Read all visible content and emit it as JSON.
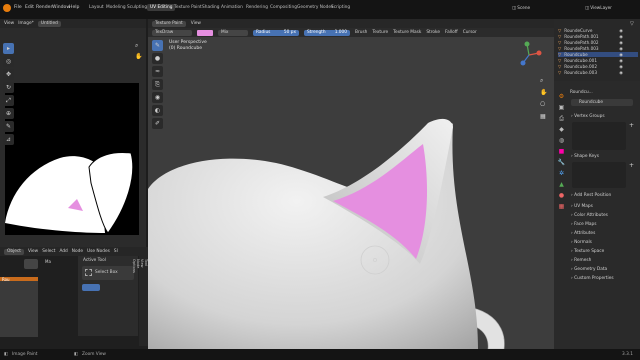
{
  "top_menu": [
    "File",
    "Edit",
    "Render",
    "Window",
    "Help"
  ],
  "workspaces": [
    "Layout",
    "Modeling",
    "Sculpting",
    "UV Editing",
    "Texture Paint",
    "Shading",
    "Animation",
    "Rendering",
    "Compositing",
    "Geometry Nodes",
    "Scripting"
  ],
  "active_workspace": "UV Editing",
  "scene_label": "Scene",
  "view_layer_label": "ViewLayer",
  "image_editor": {
    "menu": [
      "View",
      "Image*"
    ],
    "image_name": "Untitled"
  },
  "viewport_header": {
    "mode": "Texture Paint",
    "view": "View",
    "brush_name": "TexDraw",
    "blend": "Mix",
    "radius_label": "Radius",
    "radius_value": "50 px",
    "strength_label": "Strength",
    "strength_value": "1.000",
    "menus": [
      "Brush",
      "Texture",
      "Texture Mask",
      "Stroke",
      "Falloff",
      "Cursor"
    ]
  },
  "viewport_overlay": {
    "line1": "User Perspective",
    "line2": "(0) Roundcube"
  },
  "node_editor": {
    "header": [
      "Object",
      "View",
      "Select",
      "Add",
      "Node",
      "Use Nodes",
      "Sl"
    ],
    "active_tool_label": "Active Tool",
    "tool_name": "Select Box",
    "node_title": "Rou",
    "side_tabs": [
      "Tool",
      "View",
      "Node",
      "Options"
    ]
  },
  "outliner": {
    "items": [
      "RoundeCurve",
      "RoundePath.001",
      "RoundePath.002",
      "RoundePath.003",
      "Roundcube",
      "Roundcube.001",
      "Roundcube.002",
      "Roundcube.003"
    ],
    "selected_index": 4
  },
  "properties": {
    "object_label": "Roundcu...",
    "mesh_name": "Roundcube",
    "sections": [
      "Vertex Groups",
      "Shape Keys",
      "Add Rest Position",
      "UV Maps",
      "Color Attributes",
      "Face Maps",
      "Attributes",
      "Normals",
      "Texture Space",
      "Remesh",
      "Geometry Data",
      "Custom Properties"
    ]
  },
  "status_bar": {
    "left": "Image Paint",
    "middle": "Zoom View",
    "right": "3.3.1"
  },
  "colors": {
    "accent": "#4772b3",
    "mask_pink": "#e58fe0",
    "model_white": "#e6e6e6"
  }
}
